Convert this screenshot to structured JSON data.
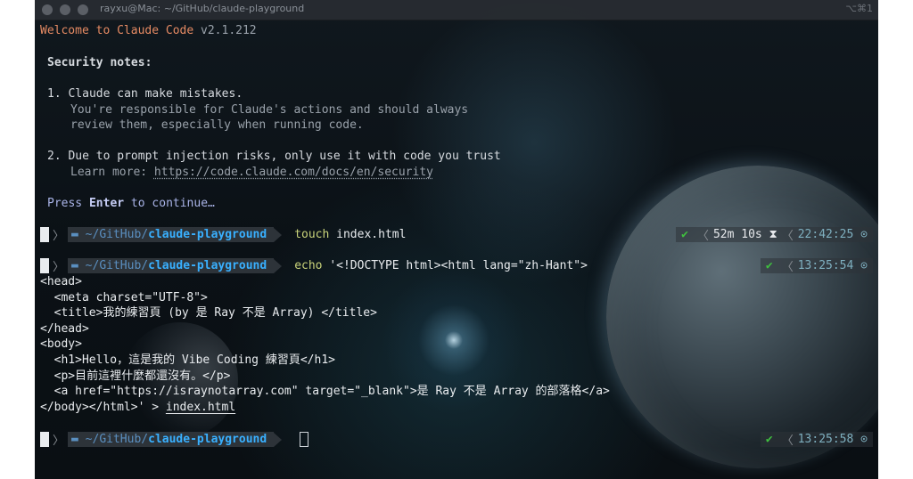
{
  "window": {
    "title": "rayxu@Mac: ~/GitHub/claude-playground",
    "shortcut": "⌥⌘1"
  },
  "welcome": {
    "text": "Welcome to Claude Code",
    "version": " v2.1.212"
  },
  "security": {
    "heading": "Security notes:",
    "note1_title": "1. Claude can make mistakes.",
    "note1_line2": "You're responsible for Claude's actions and should always",
    "note1_line3": "review them, especially when running code.",
    "note2_title": "2. Due to prompt injection risks, only use it with code you trust",
    "note2_learn": "Learn more: ",
    "note2_link": "https://code.claude.com/docs/en/security"
  },
  "press": {
    "pre": "Press ",
    "key": "Enter",
    "post": " to continue…"
  },
  "prompts": [
    {
      "path_prefix": "~/GitHub/",
      "path_dir": "claude-playground",
      "command": "touch",
      "args": " index.html",
      "status": "✔",
      "duration": "52m 10s",
      "hourglass": "⧗",
      "time": "22:42:25"
    },
    {
      "path_prefix": "~/GitHub/",
      "path_dir": "claude-playground",
      "command": "echo",
      "args": " '<!DOCTYPE html><html lang=\"zh-Hant\">",
      "status": "✔",
      "time": "13:25:54"
    },
    {
      "path_prefix": "~/GitHub/",
      "path_dir": "claude-playground",
      "status": "✔",
      "time": "13:25:58"
    }
  ],
  "heredoc": [
    "<head>",
    "  <meta charset=\"UTF-8\">",
    "  <title>我的練習頁 (by 是 Ray 不是 Array) </title>",
    "</head>",
    "<body>",
    "  <h1>Hello，這是我的 Vibe Coding 練習頁</h1>",
    "  <p>目前這裡什麼都還沒有。</p>",
    "  <a href=\"https://israynotarray.com\" target=\"_blank\">是 Ray 不是 Array 的部落格</a>"
  ],
  "heredoc_last": {
    "prefix": "</body></html>' > ",
    "file": "index.html"
  },
  "icons": {
    "apple": "",
    "folder": "▬",
    "clock": "⊙"
  },
  "colors": {
    "accent_orange": "#e58a63",
    "path_blue": "#39b0ff",
    "command_yellow": "#c9d37a",
    "success_green": "#3fbf3f"
  }
}
